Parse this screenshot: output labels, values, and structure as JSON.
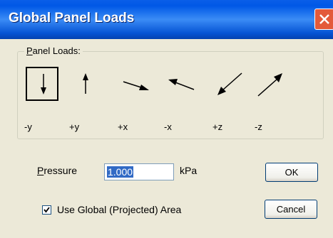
{
  "window": {
    "title": "Global Panel Loads",
    "close_icon": "close-icon"
  },
  "panel_loads": {
    "label": "Panel Loads:",
    "directions": [
      {
        "label": "-y",
        "icon": "arrow-down-icon",
        "selected": true
      },
      {
        "label": "+y",
        "icon": "arrow-up-icon",
        "selected": false
      },
      {
        "label": "+x",
        "icon": "arrow-right-down-icon",
        "selected": false
      },
      {
        "label": "-x",
        "icon": "arrow-left-up-icon",
        "selected": false
      },
      {
        "label": "+z",
        "icon": "arrow-left-down-icon",
        "selected": false
      },
      {
        "label": "-z",
        "icon": "arrow-right-up-icon",
        "selected": false
      }
    ]
  },
  "pressure": {
    "label": "Pressure",
    "value": "1.000",
    "unit": "kPa"
  },
  "buttons": {
    "ok": "OK",
    "cancel": "Cancel"
  },
  "use_global_area": {
    "label": "Use Global (Projected) Area",
    "checked": true
  },
  "colors": {
    "title_bar": "#0058e6",
    "close_button": "#e35a3a",
    "dialog_bg": "#ece9d8",
    "selection": "#316ac5"
  }
}
